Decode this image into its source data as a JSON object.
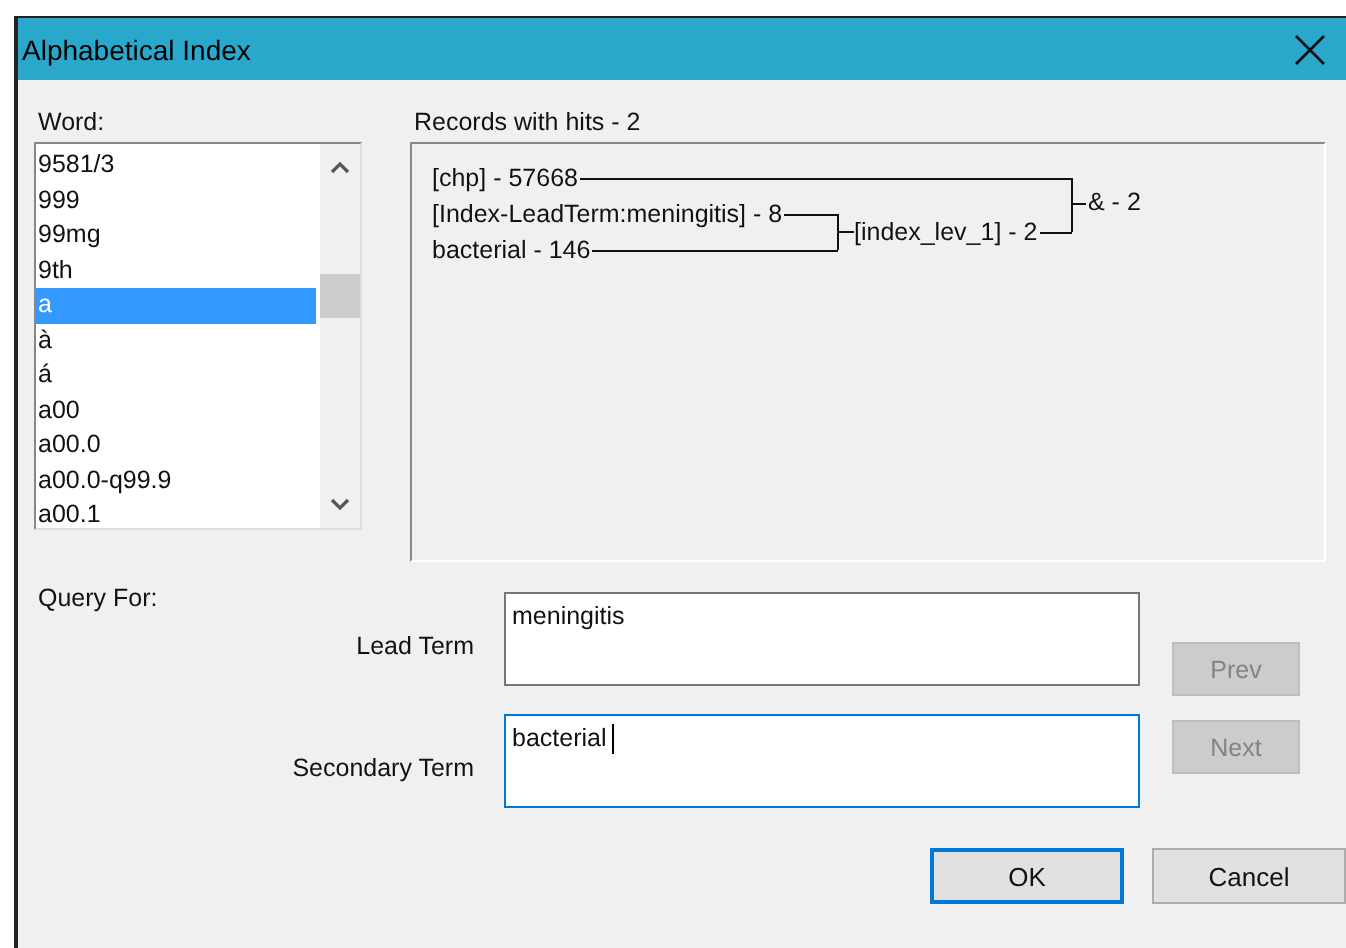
{
  "window": {
    "title": "Alphabetical Index"
  },
  "word_list": {
    "label": "Word:",
    "items": [
      {
        "text": "9581/3",
        "selected": false
      },
      {
        "text": "999",
        "selected": false
      },
      {
        "text": "99mg",
        "selected": false
      },
      {
        "text": "9th",
        "selected": false
      },
      {
        "text": "a",
        "selected": true
      },
      {
        "text": "à",
        "selected": false
      },
      {
        "text": "á",
        "selected": false
      },
      {
        "text": "a00",
        "selected": false
      },
      {
        "text": "a00.0",
        "selected": false
      },
      {
        "text": "a00.0-q99.9",
        "selected": false
      },
      {
        "text": "a00.1",
        "selected": false
      }
    ]
  },
  "results": {
    "label": "Records with hits - 2",
    "tree": {
      "label": "& - 2",
      "children": [
        {
          "label": "[chp] - 57668"
        },
        {
          "label": "[index_lev_1] - 2",
          "children": [
            {
              "label": "[Index-LeadTerm:meningitis] - 8"
            },
            {
              "label": "bacterial - 146"
            }
          ]
        }
      ]
    }
  },
  "query": {
    "label": "Query For:",
    "fields": [
      {
        "label": "Lead Term",
        "value": "meningitis",
        "focused": false
      },
      {
        "label": "Secondary Term",
        "value": "bacterial",
        "focused": true
      }
    ]
  },
  "nav_buttons": [
    {
      "label": "Prev",
      "disabled": true
    },
    {
      "label": "Next",
      "disabled": true
    }
  ],
  "buttons": [
    {
      "label": "OK",
      "default": true
    },
    {
      "label": "Cancel",
      "default": false
    }
  ]
}
